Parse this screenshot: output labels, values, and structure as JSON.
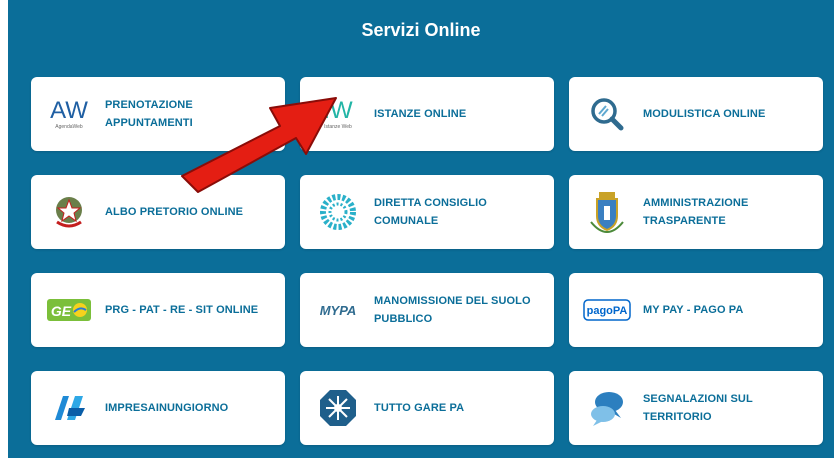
{
  "header": {
    "title": "Servizi Online"
  },
  "services": [
    {
      "name": "prenotazione-appuntamenti",
      "lines": [
        "PRENOTAZIONE",
        "APPUNTAMENTI"
      ],
      "logo": "agendaweb-logo",
      "logo_text": "AW",
      "logo_sub": "AgendaWeb"
    },
    {
      "name": "istanze-online",
      "lines": [
        "ISTANZE ONLINE"
      ],
      "logo": "istanzeweb-logo",
      "logo_text": "IW",
      "logo_sub": "Istanze Web"
    },
    {
      "name": "modulistica-online",
      "lines": [
        "MODULISTICA ONLINE"
      ],
      "logo": "magnifier-icon"
    },
    {
      "name": "albo-pretorio-online",
      "lines": [
        "ALBO PRETORIO ONLINE"
      ],
      "logo": "italian-emblem"
    },
    {
      "name": "diretta-consiglio-comunale",
      "lines": [
        "DIRETTA CONSIGLIO",
        "COMUNALE"
      ],
      "logo": "dotted-ring-logo"
    },
    {
      "name": "amministrazione-trasparente",
      "lines": [
        "AMMINISTRAZIONE",
        "TRASPARENTE"
      ],
      "logo": "municipal-coat-of-arms"
    },
    {
      "name": "prg-pat-re-sit-online",
      "lines": [
        "PRG - PAT - RE - SIT ONLINE"
      ],
      "logo": "geo-logo",
      "logo_text": "GE"
    },
    {
      "name": "manomissione-suolo-pubblico",
      "lines": [
        "MANOMISSIONE DEL SUOLO",
        "PUBBLICO"
      ],
      "logo": "mypa-logo",
      "logo_text": "MYPA"
    },
    {
      "name": "my-pay-pago-pa",
      "lines": [
        "MY PAY - PAGO PA"
      ],
      "logo": "pagopa-logo",
      "logo_text": "pagoPA"
    },
    {
      "name": "impresainungiorno",
      "lines": [
        "IMPRESAINUNGIORNO"
      ],
      "logo": "impresainungiorno-logo"
    },
    {
      "name": "tutto-gare-pa",
      "lines": [
        "TUTTO GARE PA"
      ],
      "logo": "tuttogare-logo"
    },
    {
      "name": "segnalazioni-sul-territorio",
      "lines": [
        "SEGNALAZIONI SUL",
        "TERRITORIO"
      ],
      "logo": "speech-bubbles-icon"
    }
  ],
  "annotation": {
    "arrow_color": "#e41e13",
    "arrow_target": "istanze-online"
  },
  "colors": {
    "panel": "#0b6e99",
    "card": "#ffffff",
    "label": "#0b6e99"
  }
}
